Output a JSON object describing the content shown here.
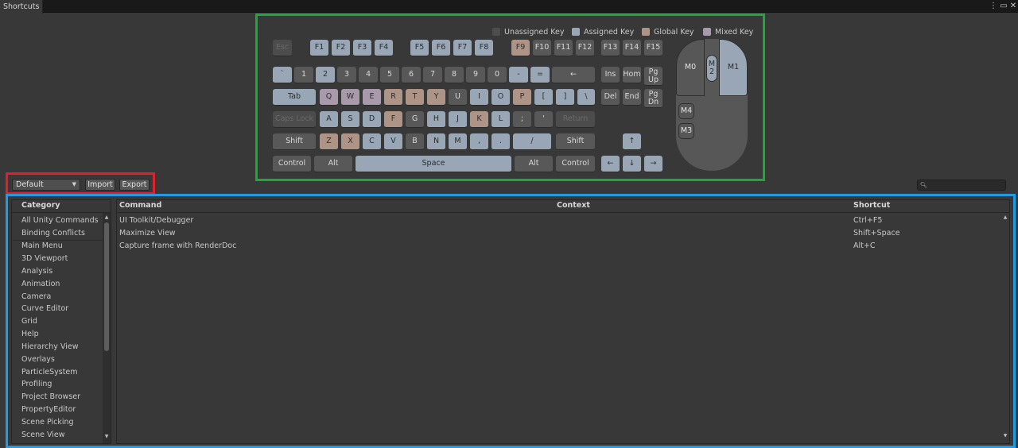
{
  "window": {
    "tab_title": "Shortcuts",
    "menu_icon": "kebab-menu-icon",
    "maximize_icon": "maximize-icon",
    "close_icon": "close-icon"
  },
  "legend": [
    {
      "label": "Unassigned Key",
      "color": "#585858"
    },
    {
      "label": "Assigned Key",
      "color": "#98a6b6"
    },
    {
      "label": "Global Key",
      "color": "#ad9487"
    },
    {
      "label": "Mixed Key",
      "color": "#a89aab"
    }
  ],
  "keys": {
    "esc": "Esc",
    "f1": "F1",
    "f2": "F2",
    "f3": "F3",
    "f4": "F4",
    "f5": "F5",
    "f6": "F6",
    "f7": "F7",
    "f8": "F8",
    "f9": "F9",
    "f10": "F10",
    "f11": "F11",
    "f12": "F12",
    "f13": "F13",
    "f14": "F14",
    "f15": "F15",
    "backquote": "`",
    "n1": "1",
    "n2": "2",
    "n3": "3",
    "n4": "4",
    "n5": "5",
    "n6": "6",
    "n7": "7",
    "n8": "8",
    "n9": "9",
    "n0": "0",
    "minus": "-",
    "equals": "=",
    "backspace": "←",
    "ins": "Ins",
    "home": "Hom",
    "pgup": "Pg Up",
    "tab": "Tab",
    "q": "Q",
    "w": "W",
    "e": "E",
    "r": "R",
    "t": "T",
    "y": "Y",
    "u": "U",
    "i": "I",
    "o": "O",
    "p": "P",
    "lbracket": "[",
    "rbracket": "]",
    "backslash": "\\",
    "del": "Del",
    "end": "End",
    "pgdn": "Pg Dn",
    "capslock": "Caps Lock",
    "a": "A",
    "s": "S",
    "d": "D",
    "f": "F",
    "g": "G",
    "h": "H",
    "j": "J",
    "k": "K",
    "l": "L",
    "semicolon": ";",
    "quote": "'",
    "return": "Return",
    "lshift": "Shift",
    "z": "Z",
    "x": "X",
    "c": "C",
    "v": "V",
    "b": "B",
    "n": "N",
    "m": "M",
    "comma": ",",
    "period": ".",
    "slash": "/",
    "rshift": "Shift",
    "up": "↑",
    "lctrl": "Control",
    "lalt": "Alt",
    "space": "Space",
    "ralt": "Alt",
    "rctrl": "Control",
    "left": "←",
    "down": "↓",
    "right": "→"
  },
  "mouse": {
    "m0": "M0",
    "m1": "M1",
    "m2": "M 2",
    "m3": "M3",
    "m4": "M4"
  },
  "toolbar": {
    "profile": "Default",
    "import": "Import",
    "export": "Export",
    "search_placeholder": "",
    "search_icon": "search-icon"
  },
  "categories": {
    "header": "Category",
    "items": [
      "All Unity Commands",
      "Binding Conflicts",
      "Main Menu",
      "3D Viewport",
      "Analysis",
      "Animation",
      "Camera",
      "Curve Editor",
      "Grid",
      "Help",
      "Hierarchy View",
      "Overlays",
      "ParticleSystem",
      "Profiling",
      "Project Browser",
      "PropertyEditor",
      "Scene Picking",
      "Scene View"
    ]
  },
  "commands": {
    "headers": {
      "command": "Command",
      "context": "Context",
      "shortcut": "Shortcut"
    },
    "rows": [
      {
        "command": "UI Toolkit/Debugger",
        "context": "",
        "shortcut": "Ctrl+F5"
      },
      {
        "command": "Maximize View",
        "context": "",
        "shortcut": "Shift+Space"
      },
      {
        "command": "Capture frame with RenderDoc",
        "context": "",
        "shortcut": "Alt+C"
      }
    ]
  }
}
